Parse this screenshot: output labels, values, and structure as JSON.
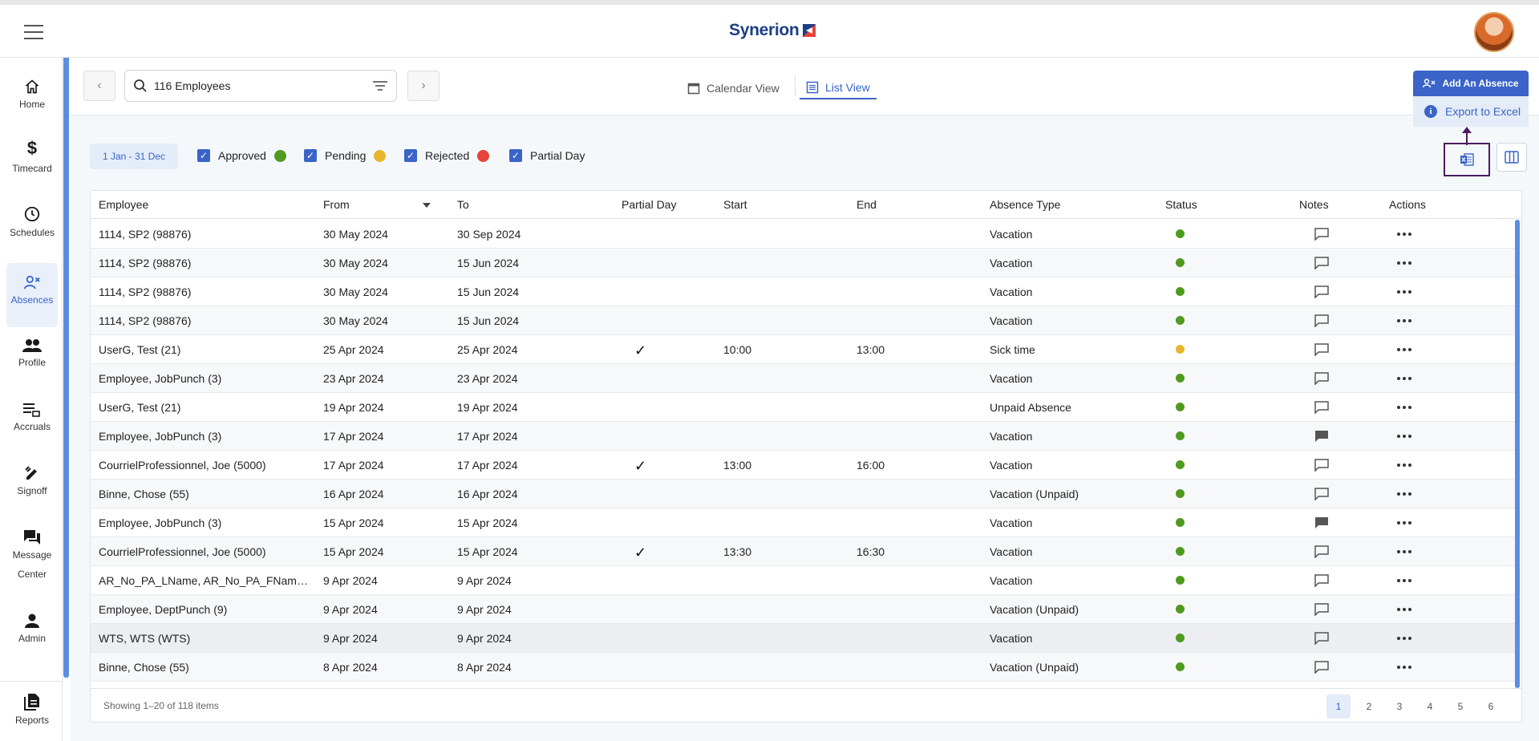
{
  "app": {
    "brand": "Synerion"
  },
  "nav": {
    "items": [
      {
        "label": "Home",
        "icon": "home-icon"
      },
      {
        "label": "Timecard",
        "icon": "dollar-icon"
      },
      {
        "label": "Schedules",
        "icon": "clock-icon"
      },
      {
        "label": "Absences",
        "icon": "person-remove-icon",
        "active": true
      },
      {
        "label": "Profile",
        "icon": "people-icon"
      },
      {
        "label": "Accruals",
        "icon": "list-icon"
      },
      {
        "label": "Signoff",
        "icon": "signoff-icon"
      },
      {
        "label": "Message Center",
        "icon": "chat-icon"
      },
      {
        "label": "Admin",
        "icon": "person-icon"
      },
      {
        "label": "Reports",
        "icon": "reports-icon"
      }
    ]
  },
  "toolbar": {
    "search_value": "116 Employees",
    "calendar_view": "Calendar View",
    "list_view": "List View",
    "add_absence": "Add An Absence",
    "export_excel": "Export to Excel"
  },
  "filters": {
    "date_range": "1 Jan - 31 Dec",
    "legend": [
      {
        "label": "Approved",
        "color": "#4f9a1f"
      },
      {
        "label": "Pending",
        "color": "#e8b62e"
      },
      {
        "label": "Rejected",
        "color": "#e8423a"
      },
      {
        "label": "Partial Day"
      }
    ]
  },
  "table": {
    "columns": [
      "Employee",
      "From",
      "To",
      "Partial Day",
      "Start",
      "End",
      "Absence Type",
      "Status",
      "Notes",
      "Actions"
    ],
    "rows": [
      {
        "employee": "1114, SP2 (98876)",
        "from": "30 May 2024",
        "to": "30 Sep 2024",
        "partial": false,
        "start": "",
        "end": "",
        "type": "Vacation",
        "status": "approved",
        "note_filled": false
      },
      {
        "employee": "1114, SP2 (98876)",
        "from": "30 May 2024",
        "to": "15 Jun 2024",
        "partial": false,
        "start": "",
        "end": "",
        "type": "Vacation",
        "status": "approved",
        "note_filled": false
      },
      {
        "employee": "1114, SP2 (98876)",
        "from": "30 May 2024",
        "to": "15 Jun 2024",
        "partial": false,
        "start": "",
        "end": "",
        "type": "Vacation",
        "status": "approved",
        "note_filled": false
      },
      {
        "employee": "1114, SP2 (98876)",
        "from": "30 May 2024",
        "to": "15 Jun 2024",
        "partial": false,
        "start": "",
        "end": "",
        "type": "Vacation",
        "status": "approved",
        "note_filled": false
      },
      {
        "employee": "UserG, Test (21)",
        "from": "25 Apr 2024",
        "to": "25 Apr 2024",
        "partial": true,
        "start": "10:00",
        "end": "13:00",
        "type": "Sick time",
        "status": "pending",
        "note_filled": false
      },
      {
        "employee": "Employee, JobPunch (3)",
        "from": "23 Apr 2024",
        "to": "23 Apr 2024",
        "partial": false,
        "start": "",
        "end": "",
        "type": "Vacation",
        "status": "approved",
        "note_filled": false
      },
      {
        "employee": "UserG, Test (21)",
        "from": "19 Apr 2024",
        "to": "19 Apr 2024",
        "partial": false,
        "start": "",
        "end": "",
        "type": "Unpaid Absence",
        "status": "approved",
        "note_filled": false
      },
      {
        "employee": "Employee, JobPunch (3)",
        "from": "17 Apr 2024",
        "to": "17 Apr 2024",
        "partial": false,
        "start": "",
        "end": "",
        "type": "Vacation",
        "status": "approved",
        "note_filled": true
      },
      {
        "employee": "CourrielProfessionnel, Joe (5000)",
        "from": "17 Apr 2024",
        "to": "17 Apr 2024",
        "partial": true,
        "start": "13:00",
        "end": "16:00",
        "type": "Vacation",
        "status": "approved",
        "note_filled": false
      },
      {
        "employee": "Binne, Chose (55)",
        "from": "16 Apr 2024",
        "to": "16 Apr 2024",
        "partial": false,
        "start": "",
        "end": "",
        "type": "Vacation (Unpaid)",
        "status": "approved",
        "note_filled": false
      },
      {
        "employee": "Employee, JobPunch (3)",
        "from": "15 Apr 2024",
        "to": "15 Apr 2024",
        "partial": false,
        "start": "",
        "end": "",
        "type": "Vacation",
        "status": "approved",
        "note_filled": true
      },
      {
        "employee": "CourrielProfessionnel, Joe (5000)",
        "from": "15 Apr 2024",
        "to": "15 Apr 2024",
        "partial": true,
        "start": "13:30",
        "end": "16:30",
        "type": "Vacation",
        "status": "approved",
        "note_filled": false
      },
      {
        "employee": "AR_No_PA_LName, AR_No_PA_FName (...",
        "from": "9 Apr 2024",
        "to": "9 Apr 2024",
        "partial": false,
        "start": "",
        "end": "",
        "type": "Vacation",
        "status": "approved",
        "note_filled": false
      },
      {
        "employee": "Employee, DeptPunch (9)",
        "from": "9 Apr 2024",
        "to": "9 Apr 2024",
        "partial": false,
        "start": "",
        "end": "",
        "type": "Vacation (Unpaid)",
        "status": "approved",
        "note_filled": false
      },
      {
        "employee": "WTS, WTS (WTS)",
        "from": "9 Apr 2024",
        "to": "9 Apr 2024",
        "partial": false,
        "start": "",
        "end": "",
        "type": "Vacation",
        "status": "approved",
        "note_filled": false
      },
      {
        "employee": "Binne, Chose (55)",
        "from": "8 Apr 2024",
        "to": "8 Apr 2024",
        "partial": false,
        "start": "",
        "end": "",
        "type": "Vacation (Unpaid)",
        "status": "approved",
        "note_filled": false
      }
    ],
    "showing": "Showing 1–20 of 118 items",
    "pages": [
      "1",
      "2",
      "3",
      "4",
      "5",
      "6"
    ],
    "current_page": "1"
  },
  "status_colors": {
    "approved": "#4f9a1f",
    "pending": "#e8b62e",
    "rejected": "#e8423a"
  }
}
